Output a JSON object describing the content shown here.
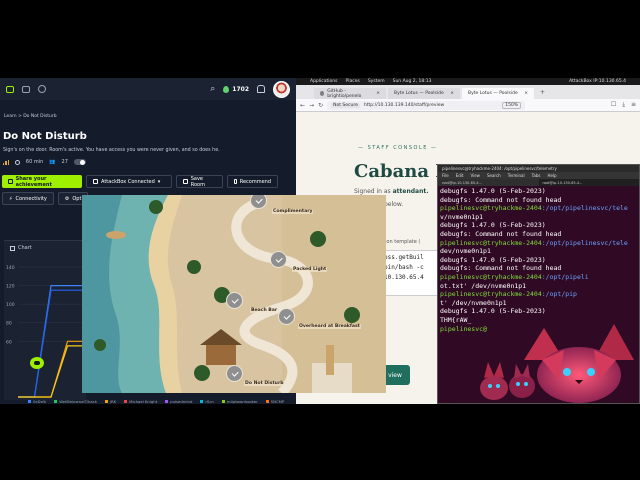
{
  "thm": {
    "streak_count": "1702",
    "breadcrumb": "Learn > Do Not Disturb",
    "room_title": "Do Not Disturb",
    "room_subtitle": "Sign's on the door. Room's active. You have access you were never given, and so does he.",
    "duration": "60 min",
    "users": "27",
    "buttons": {
      "share": "Share your achievement",
      "attackbox": "AttackBox Connected",
      "save": "Save Room",
      "recommend": "Recommend"
    },
    "tabs": {
      "connectivity": "Connectivity",
      "options": "Opt"
    },
    "chart_label": "Chart",
    "legend": [
      "0xDelk",
      "WellBelownof?/hack",
      "jRK",
      "Michael Knight",
      "pulsedmind",
      "rScn",
      "m4ptownhooker",
      "SNCMP"
    ]
  },
  "chart_data": {
    "type": "line",
    "yticks": [
      140,
      120,
      100,
      80,
      60
    ],
    "ylim": [
      0,
      140
    ],
    "series": [
      {
        "color": "#3b82f6",
        "values": [
          0,
          0,
          120,
          120,
          120
        ]
      },
      {
        "color": "#2563eb",
        "values": [
          0,
          0,
          115,
          115,
          115
        ]
      },
      {
        "color": "#f59e0b",
        "values": [
          0,
          0,
          0,
          60,
          60
        ]
      },
      {
        "color": "#facc15",
        "values": [
          0,
          0,
          0,
          55,
          55
        ]
      }
    ]
  },
  "vm": {
    "panel": {
      "applications": "Applications",
      "places": "Places",
      "system": "System",
      "datetime": "Sun Aug 2, 18:13",
      "ip": "AttackBox IP:10.130.65.4"
    },
    "browser": {
      "tabs": [
        {
          "label": "GitHub - brightio/penelo"
        },
        {
          "label": "Byte Lotus — Poolside"
        },
        {
          "label": "Byte Lotus — Poolside"
        }
      ],
      "not_secure": "Not Secure",
      "url": "http://10.130.139.140/staff/preview",
      "zoom": "150%"
    },
    "page": {
      "kicker": "— STAFF CONSOLE —",
      "heading": "Cabana D",
      "signed_prefix": "Signed in as",
      "signed_user": "attendant.",
      "below": "below.",
      "template_label": "ation template (",
      "template_lines": [
        "ess.getBuil",
        "bin/bash -c",
        "10.130.65.4"
      ],
      "preview_button": "view"
    },
    "terminal": {
      "title": "pipelinesvc@tryhackme-2404: /opt/pipelinesvc/telemetry",
      "menu": [
        "File",
        "Edit",
        "View",
        "Search",
        "Terminal",
        "Tabs",
        "Help"
      ],
      "tab_a": "root@ip-10-130-65-4...",
      "tab_b": "root@ip-10-130-65-4...",
      "lines": [
        {
          "kind": "out",
          "text": "debugfs 1.47.0 (5-Feb-2023)"
        },
        {
          "kind": "out",
          "text": "debugfs: Command not found head"
        },
        {
          "kind": "prompt",
          "user": "pipelinesvc@tryhackme-2404",
          "path": ":/opt/pipelinesvc/tele"
        },
        {
          "kind": "out",
          "text": "v/nvme0n1p1"
        },
        {
          "kind": "out",
          "text": "debugfs 1.47.0 (5-Feb-2023)"
        },
        {
          "kind": "out",
          "text": "debugfs: Command not found head"
        },
        {
          "kind": "prompt",
          "user": "pipelinesvc@tryhackme-2404",
          "path": ":/opt/pipelinesvc/tele"
        },
        {
          "kind": "out",
          "text": "dev/nvme0n1p1"
        },
        {
          "kind": "out",
          "text": "debugfs 1.47.0 (5-Feb-2023)"
        },
        {
          "kind": "out",
          "text": "debugfs: Command not found head"
        },
        {
          "kind": "prompt",
          "user": "pipelinesvc@tryhackme-2404",
          "path": ":/opt/pipeli"
        },
        {
          "kind": "out",
          "text": "ot.txt' /dev/nvme0n1p1"
        },
        {
          "kind": "prompt",
          "user": "pipelinesvc@tryhackme-2404",
          "path": ":/opt/pip"
        },
        {
          "kind": "out",
          "text": "t' /dev/nvme0n1p1"
        },
        {
          "kind": "out",
          "text": "debugfs 1.47.0 (5-Feb-2023)"
        },
        {
          "kind": "out",
          "text": "THM{rAW_"
        },
        {
          "kind": "prompt",
          "user": "pipelinesvc@",
          "path": ""
        }
      ]
    }
  },
  "map": {
    "labels": [
      "Complimentary",
      "Packed Light",
      "Beach Bar",
      "Overheard at Breakfast",
      "Do Not Disturb"
    ]
  }
}
